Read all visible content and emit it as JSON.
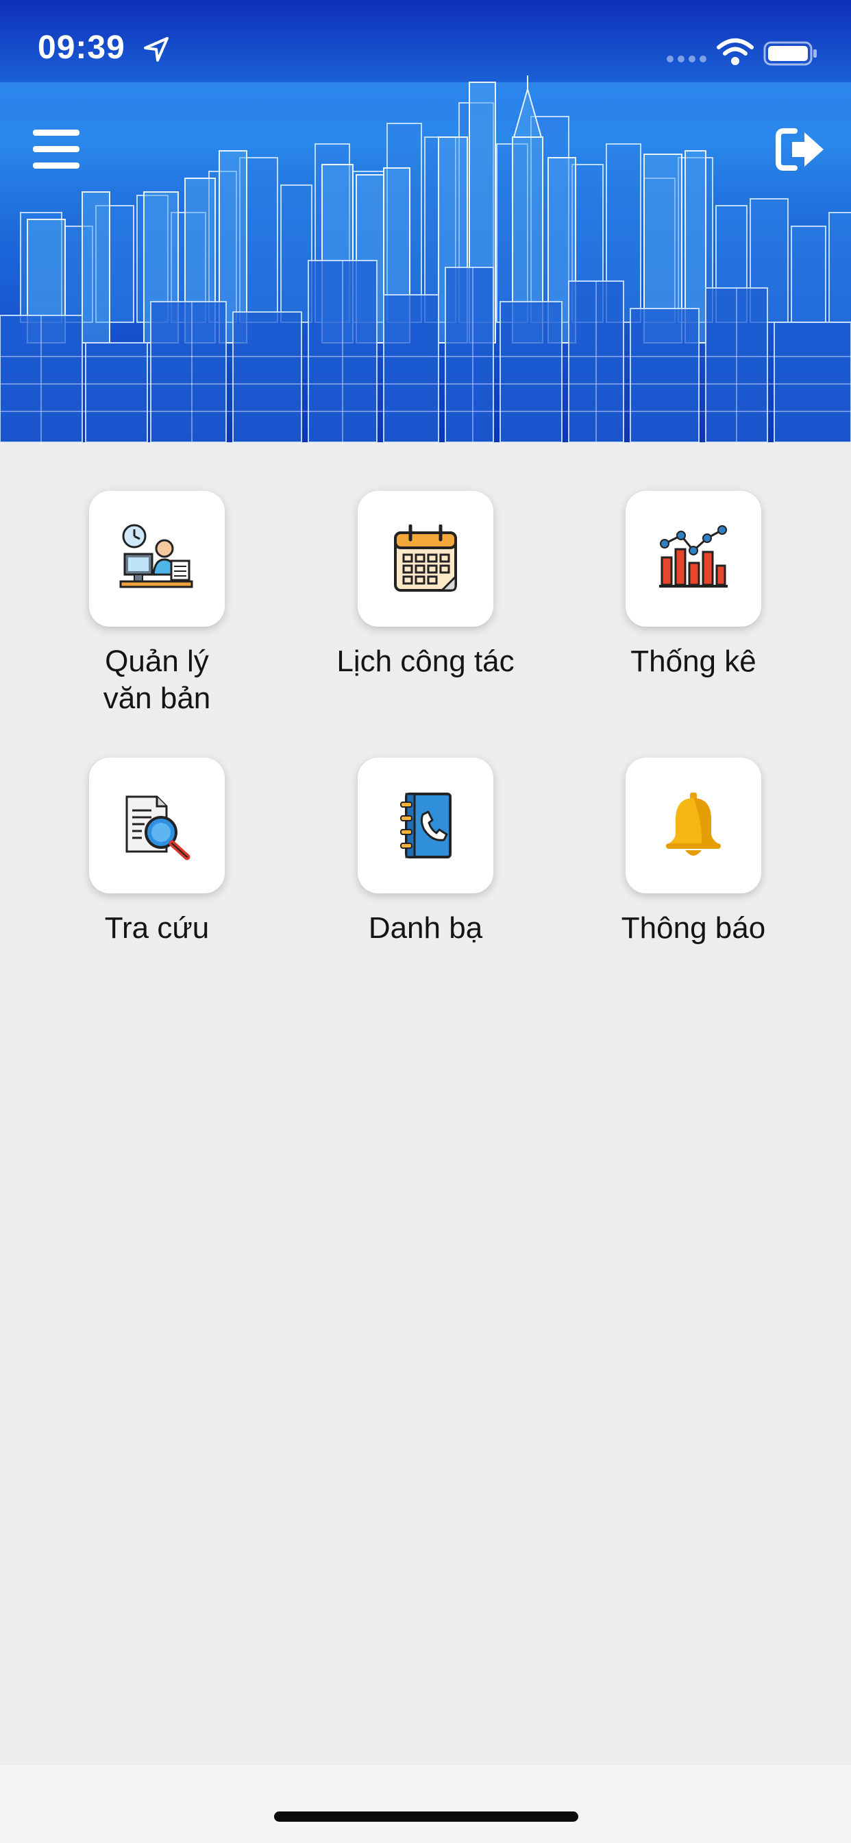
{
  "status_bar": {
    "time": "09:39",
    "location_icon": "location-arrow-icon",
    "wifi_icon": "wifi-icon",
    "battery_icon": "battery-icon"
  },
  "header": {
    "menu_icon": "hamburger-menu-icon",
    "logout_icon": "logout-icon",
    "banner_image": "city-skyline-wireframe",
    "colors": {
      "banner_dark": "#0d35b5",
      "banner_light": "#2a8df0"
    }
  },
  "tiles": [
    {
      "label": "Quản lý\nvăn bản",
      "icon": "document-management-icon"
    },
    {
      "label": "Lịch công tác",
      "icon": "calendar-icon"
    },
    {
      "label": "Thống kê",
      "icon": "statistics-chart-icon"
    },
    {
      "label": "Tra cứu",
      "icon": "search-document-icon"
    },
    {
      "label": "Danh bạ",
      "icon": "phonebook-icon"
    },
    {
      "label": "Thông báo",
      "icon": "bell-icon"
    }
  ],
  "colors": {
    "background": "#ededed",
    "tile_background": "#ffffff",
    "text": "#141414"
  }
}
